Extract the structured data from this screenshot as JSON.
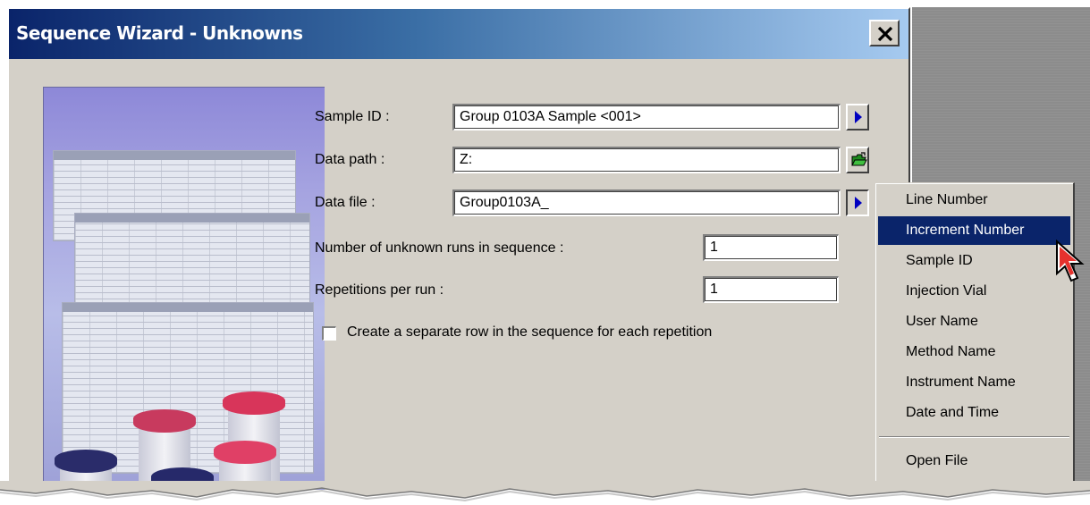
{
  "window": {
    "title": "Sequence Wizard - Unknowns",
    "close_icon": "close-x-icon"
  },
  "form": {
    "sample_id": {
      "label": "Sample ID :",
      "value": "Group 0103A Sample <001>",
      "button_icon": "arrow-right-icon"
    },
    "data_path": {
      "label": "Data path :",
      "value": "Z:",
      "button_icon": "open-folder-icon"
    },
    "data_file": {
      "label": "Data file :",
      "value": "Group0103A_",
      "button_icon": "arrow-right-icon"
    },
    "unknown_runs": {
      "label": "Number of unknown runs in sequence :",
      "value": "1"
    },
    "repetitions": {
      "label": "Repetitions per run :",
      "value": "1"
    },
    "separate_row": {
      "label": "Create a separate row in the sequence for each repetition",
      "checked": false
    }
  },
  "menu": {
    "items": [
      {
        "label": "Line Number",
        "highlighted": false
      },
      {
        "label": "Increment Number",
        "highlighted": true
      },
      {
        "label": "Sample ID",
        "highlighted": false
      },
      {
        "label": "Injection Vial",
        "highlighted": false
      },
      {
        "label": "User Name",
        "highlighted": false
      },
      {
        "label": "Method Name",
        "highlighted": false
      },
      {
        "label": "Instrument Name",
        "highlighted": false
      },
      {
        "label": "Date and Time",
        "highlighted": false
      }
    ],
    "footer_item": {
      "label": "Open File"
    }
  },
  "colors": {
    "title_gradient_start": "#0a246a",
    "title_gradient_end": "#a6caf0",
    "dialog_face": "#d4d0c8",
    "menu_highlight": "#0a246a",
    "arrow_blue": "#0000c0",
    "folder_green": "#1e8a1e"
  }
}
